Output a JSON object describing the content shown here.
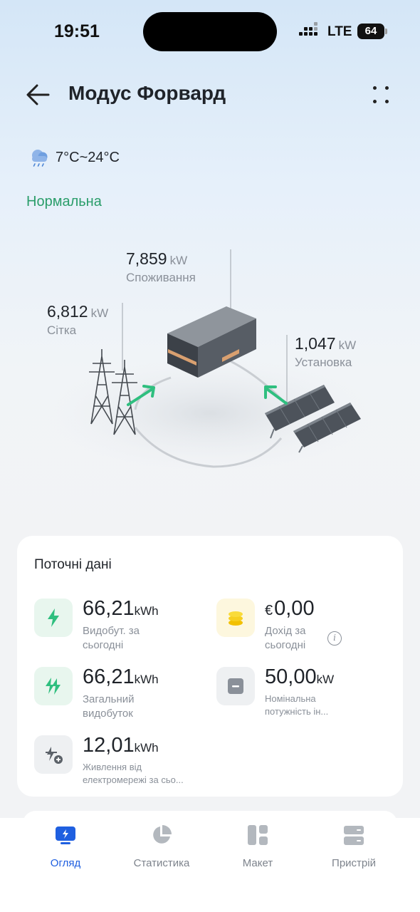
{
  "status_bar": {
    "time": "19:51",
    "network": "LTE",
    "battery": "64"
  },
  "header": {
    "title": "Модус Форвард",
    "back_icon": "arrow-left-icon",
    "more_icon": "more-dots-icon"
  },
  "weather": {
    "icon": "cloud-rain-icon",
    "temperature": "7°C~24°C"
  },
  "plant_status": "Нормальна",
  "flow": {
    "consumption": {
      "value": "7,859",
      "unit": "kW",
      "label": "Споживання"
    },
    "grid": {
      "value": "6,812",
      "unit": "kW",
      "label": "Сітка"
    },
    "installation": {
      "value": "1,047",
      "unit": "kW",
      "label": "Установка"
    }
  },
  "current_data": {
    "title": "Поточні дані",
    "metrics": [
      {
        "value": "66,21",
        "unit": "kWh",
        "label": "Видобут. за сьогодні",
        "icon": "bolt-icon"
      },
      {
        "currency": "€",
        "value": "0,00",
        "label": "Дохід за сьогодні",
        "icon": "coins-icon"
      },
      {
        "value": "66,21",
        "unit": "kWh",
        "label": "Загальний видобуток",
        "icon": "double-bolt-icon"
      },
      {
        "value": "50,00",
        "unit": "kW",
        "label": "Номінальна потужність ін...",
        "icon": "inverter-icon"
      },
      {
        "value": "12,01",
        "unit": "kWh",
        "label": "Живлення від електромережі за сьо...",
        "icon": "grid-plus-icon"
      }
    ]
  },
  "tabs": [
    {
      "label": "Огляд",
      "icon": "overview-icon",
      "active": true
    },
    {
      "label": "Статистика",
      "icon": "pie-chart-icon",
      "active": false
    },
    {
      "label": "Макет",
      "icon": "layout-icon",
      "active": false
    },
    {
      "label": "Пристрій",
      "icon": "device-icon",
      "active": false
    }
  ],
  "colors": {
    "accent": "#1f5fe0",
    "status_green": "#2a9d6a",
    "flow_arrow": "#2fbf7f"
  }
}
